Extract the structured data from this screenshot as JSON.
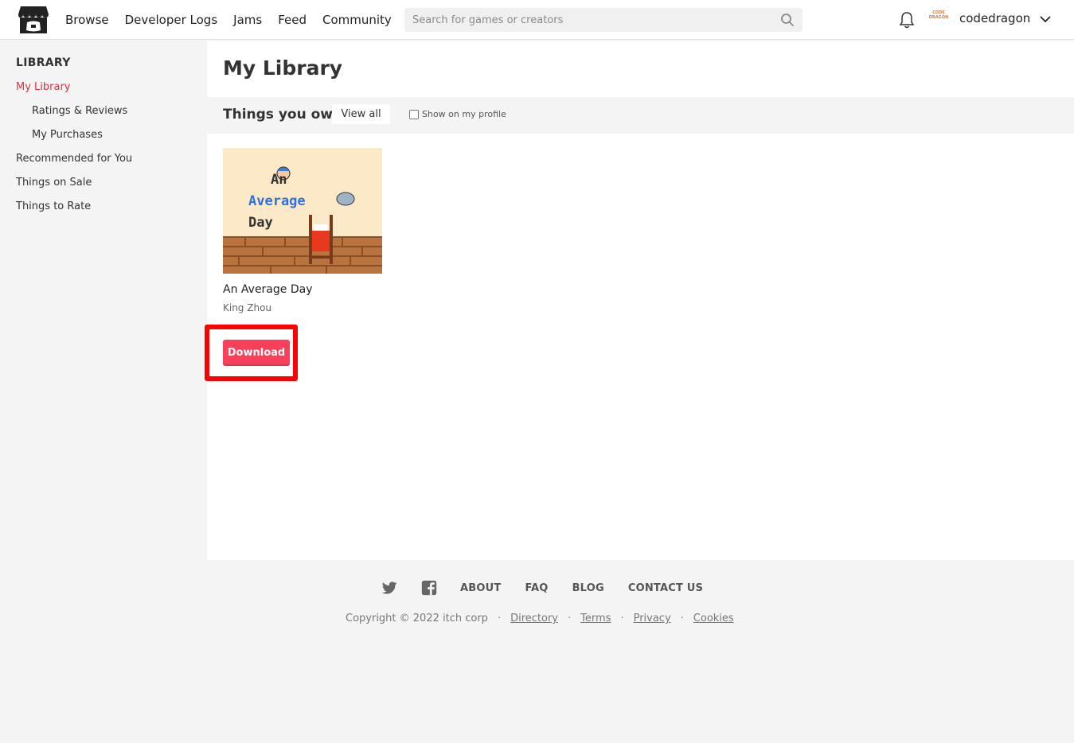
{
  "header": {
    "nav": [
      "Browse",
      "Developer Logs",
      "Jams",
      "Feed",
      "Community"
    ],
    "search_placeholder": "Search for games or creators",
    "username": "codedragon",
    "avatar_text": "CODE DRAGON"
  },
  "sidebar": {
    "heading": "LIBRARY",
    "items": [
      {
        "label": "My Library"
      },
      {
        "label": "Ratings & Reviews"
      },
      {
        "label": "My Purchases"
      },
      {
        "label": "Recommended for You"
      },
      {
        "label": "Things on Sale"
      },
      {
        "label": "Things to Rate"
      }
    ]
  },
  "main": {
    "title": "My Library",
    "section_title": "Things you own",
    "view_all": "View all",
    "show_profile": "Show on my profile",
    "game": {
      "title": "An Average Day",
      "author": "King Zhou",
      "cover_text": [
        "An",
        "Average",
        "Day"
      ],
      "download": "Download"
    }
  },
  "footer": {
    "links": [
      "ABOUT",
      "FAQ",
      "BLOG",
      "CONTACT US"
    ],
    "copyright": "Copyright © 2022 itch corp",
    "legal": [
      "Directory",
      "Terms",
      "Privacy",
      "Cookies"
    ]
  },
  "colors": {
    "accent": "#d83343",
    "download_bg": "#fa3f5b",
    "highlight": "#ff0000"
  }
}
